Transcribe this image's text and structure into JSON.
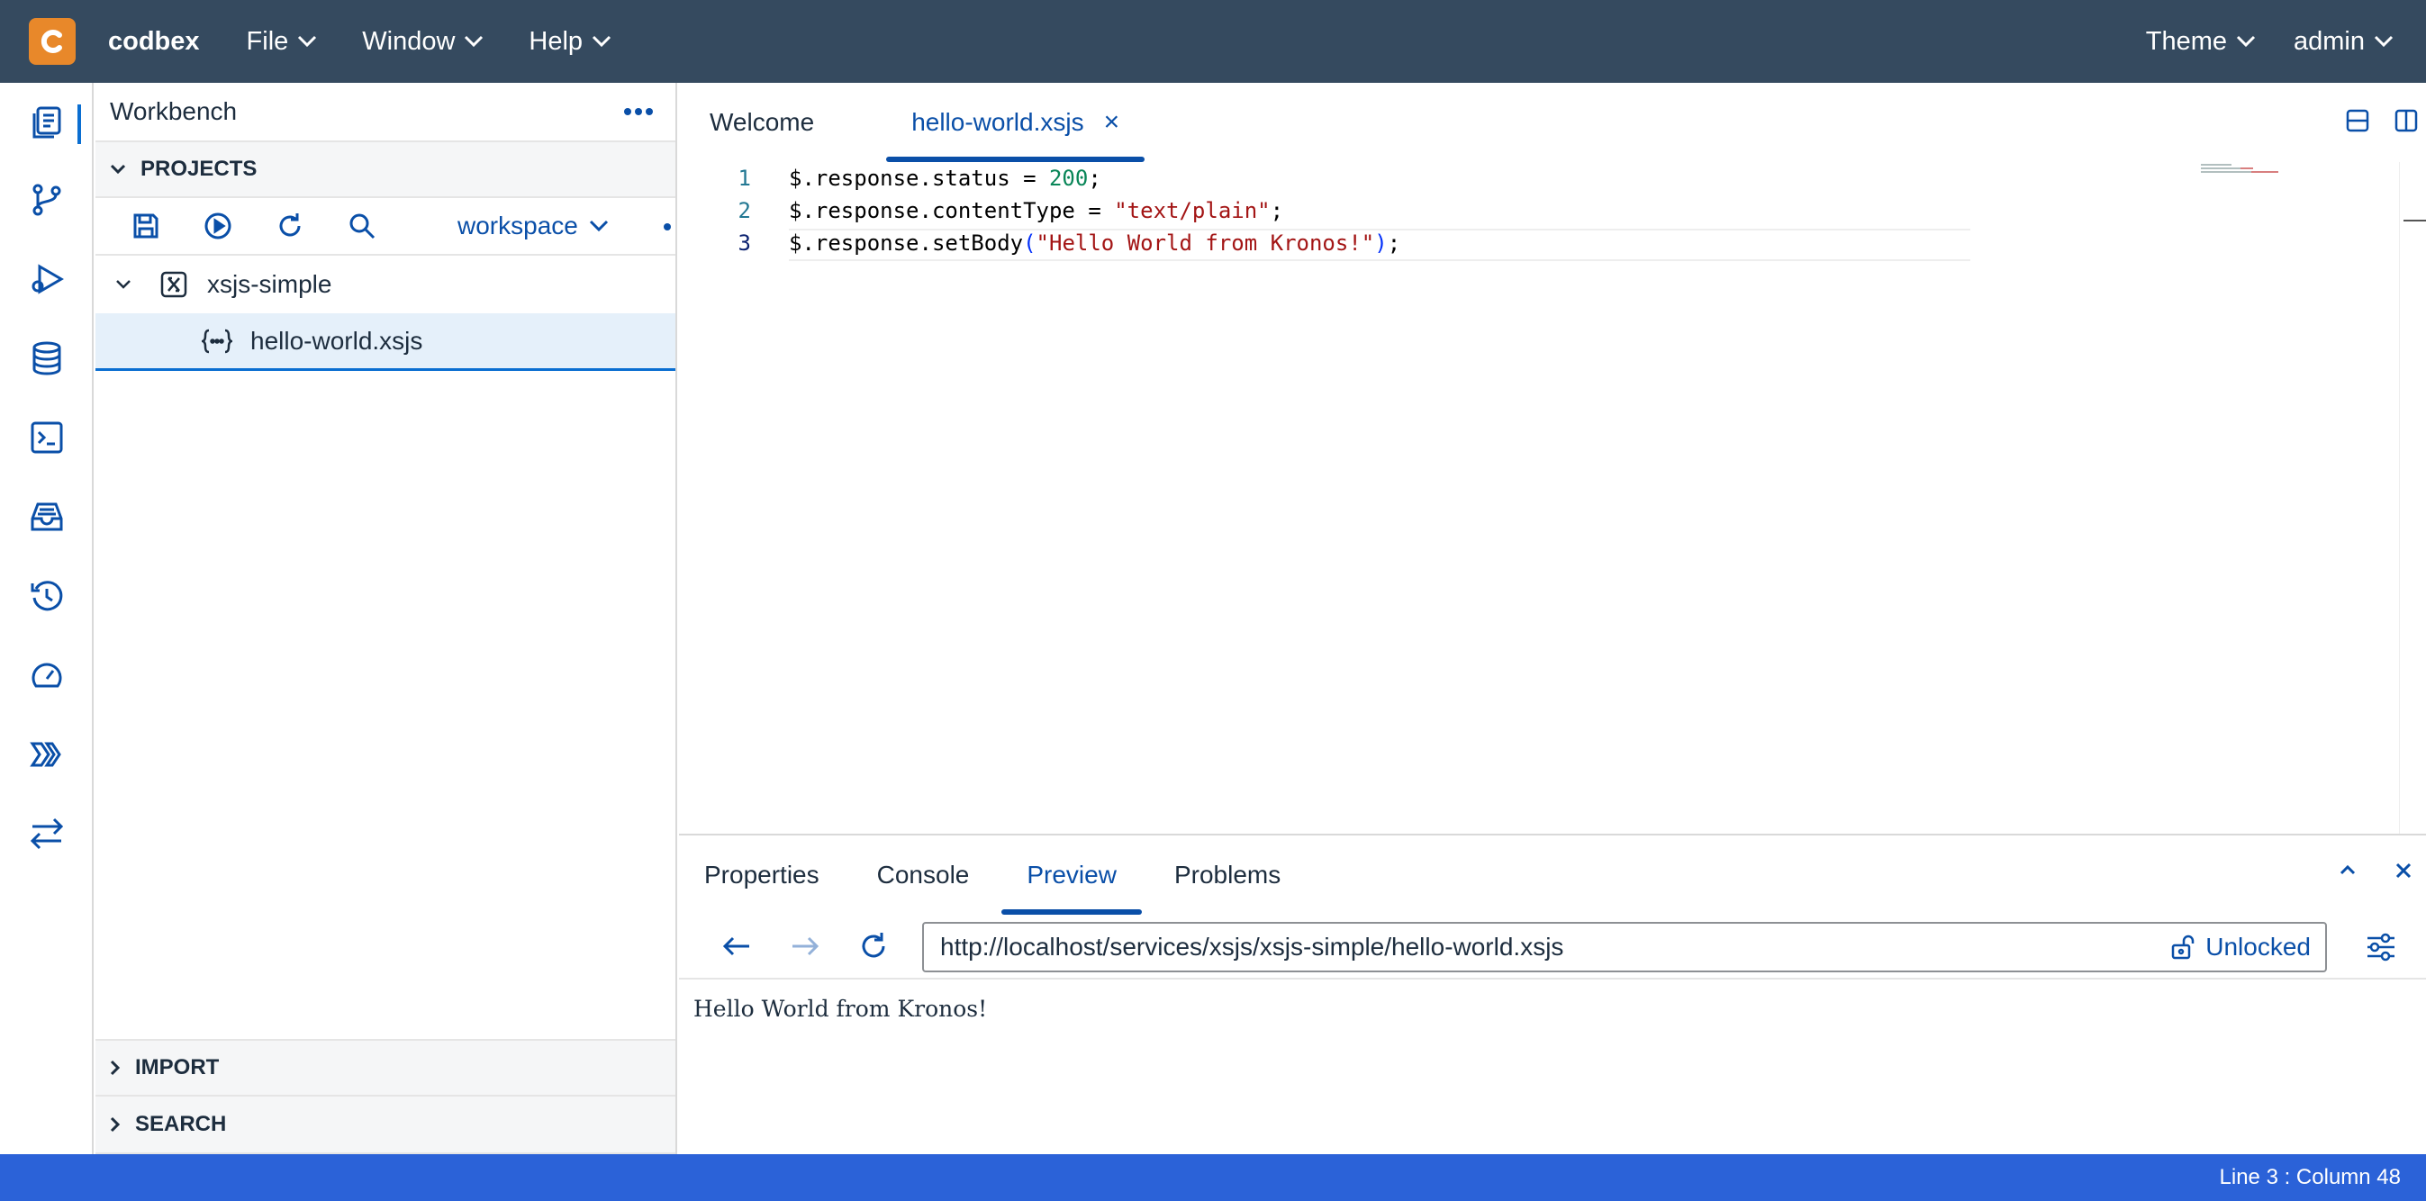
{
  "app": {
    "brand": "codbex"
  },
  "topbar": {
    "menus": [
      "File",
      "Window",
      "Help"
    ],
    "theme_label": "Theme",
    "user_label": "admin"
  },
  "activity": [
    "explorer-icon",
    "git-icon",
    "debug-icon",
    "database-icon",
    "terminal-icon",
    "inbox-icon",
    "history-icon",
    "gauge-icon",
    "pipeline-icon",
    "transfer-icon"
  ],
  "sidepanel": {
    "title": "Workbench",
    "projects_label": "PROJECTS",
    "workspace_label": "workspace",
    "tree": [
      {
        "label": "xsjs-simple",
        "type": "project"
      },
      {
        "label": "hello-world.xsjs",
        "type": "file"
      }
    ],
    "import_label": "IMPORT",
    "search_label": "SEARCH"
  },
  "editor": {
    "tabs": [
      {
        "label": "Welcome"
      },
      {
        "label": "hello-world.xsjs"
      }
    ],
    "close_glyph": "×",
    "lines": [
      {
        "n": "1",
        "parts": [
          "$.response.status = ",
          "200",
          ";"
        ]
      },
      {
        "n": "2",
        "parts": [
          "$.response.contentType = ",
          "\"text/plain\"",
          ";"
        ]
      },
      {
        "n": "3",
        "parts": [
          "$.response.setBody",
          "(",
          "\"Hello World from Kronos!\"",
          ")",
          ";"
        ]
      }
    ]
  },
  "bottom": {
    "tabs": [
      "Properties",
      "Console",
      "Preview",
      "Problems"
    ],
    "url": "http://localhost/services/xsjs/xsjs-simple/hello-world.xsjs",
    "lock_label": "Unlocked",
    "output": "Hello World from Kronos!"
  },
  "status": {
    "position": "Line 3 : Column 48"
  },
  "colors": {
    "topbar": "#354a5f",
    "accent": "#0a4fa8",
    "statusbar": "#2b62d8",
    "logo": "#e8882a"
  }
}
